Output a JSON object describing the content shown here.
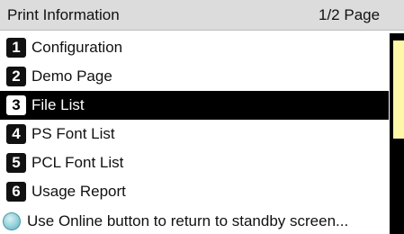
{
  "header": {
    "title": "Print Information",
    "page": "1/2 Page"
  },
  "menu": {
    "items": [
      {
        "number": "1",
        "label": "Configuration",
        "selected": false
      },
      {
        "number": "2",
        "label": "Demo Page",
        "selected": false
      },
      {
        "number": "3",
        "label": "File List",
        "selected": true
      },
      {
        "number": "4",
        "label": "PS Font List",
        "selected": false
      },
      {
        "number": "5",
        "label": "PCL Font List",
        "selected": false
      },
      {
        "number": "6",
        "label": "Usage Report",
        "selected": false
      }
    ]
  },
  "footer": {
    "icon": "online-button-icon",
    "text": "Use Online button to return to standby screen..."
  },
  "colors": {
    "header_bg": "#dcdcdc",
    "selection_bg": "#000000",
    "scroll_thumb": "#fff7a8",
    "online_button": "#9fd6de"
  }
}
